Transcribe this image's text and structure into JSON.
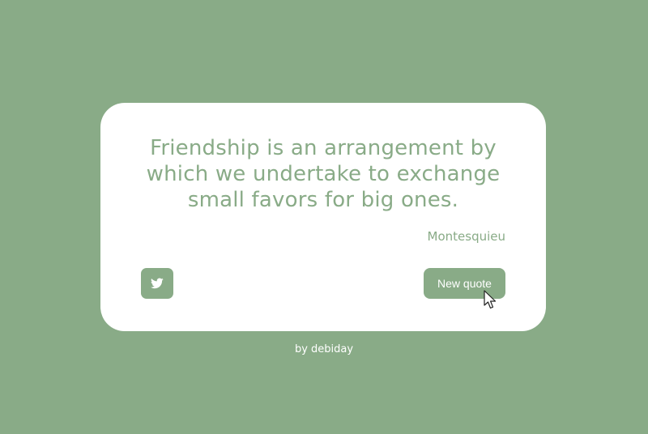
{
  "theme": {
    "background": "#89ab87",
    "card": "#ffffff",
    "accent": "#89ab87",
    "button_text": "#ffffff"
  },
  "quote": {
    "text": "Friendship is an arrangement by which we undertake to exchange small favors for big ones.",
    "author": "Montesquieu"
  },
  "actions": {
    "tweet_icon": "twitter-icon",
    "new_quote_label": "New quote"
  },
  "footer": {
    "credit": "by debiday"
  }
}
